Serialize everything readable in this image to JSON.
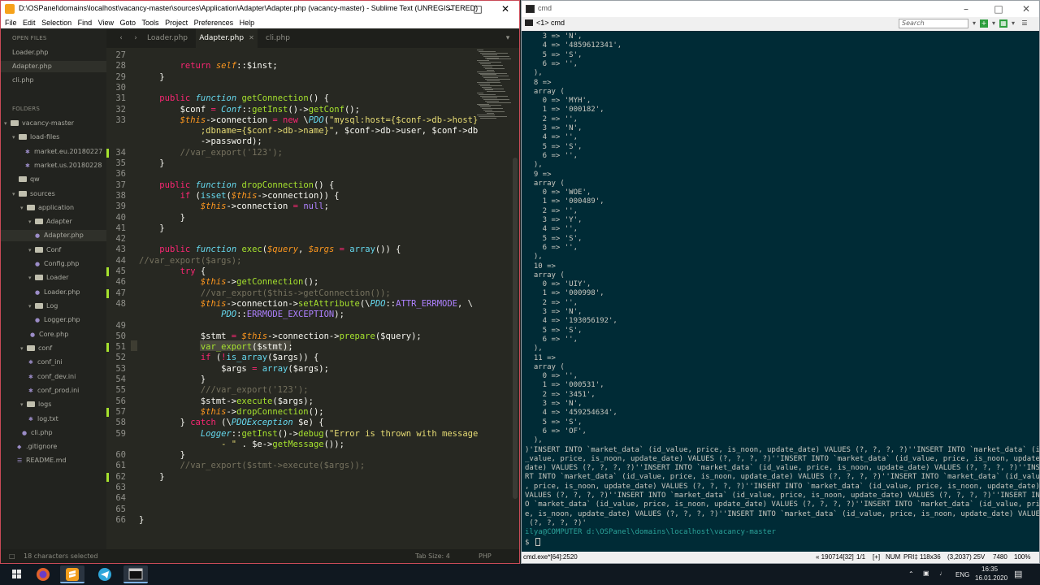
{
  "sublime": {
    "title": "D:\\OSPanel\\domains\\localhost\\vacancy-master\\sources\\Application\\Adapter\\Adapter.php (vacancy-master) - Sublime Text (UNREGISTERED)",
    "menu": [
      "File",
      "Edit",
      "Selection",
      "Find",
      "View",
      "Goto",
      "Tools",
      "Project",
      "Preferences",
      "Help"
    ],
    "sidebar": {
      "open_files_header": "OPEN FILES",
      "open_files": [
        "Loader.php",
        "Adapter.php",
        "cli.php"
      ],
      "folders_header": "FOLDERS",
      "tree": [
        {
          "label": "vacancy-master",
          "type": "folder"
        },
        {
          "label": "load-files",
          "type": "folder"
        },
        {
          "label": "market.eu.20180227",
          "type": "file"
        },
        {
          "label": "market.us.20180228",
          "type": "file"
        },
        {
          "label": "qw",
          "type": "folder"
        },
        {
          "label": "sources",
          "type": "folder"
        },
        {
          "label": "application",
          "type": "folder"
        },
        {
          "label": "Adapter",
          "type": "folder"
        },
        {
          "label": "Adapter.php",
          "type": "file"
        },
        {
          "label": "Conf",
          "type": "folder"
        },
        {
          "label": "Config.php",
          "type": "file"
        },
        {
          "label": "Loader",
          "type": "folder"
        },
        {
          "label": "Loader.php",
          "type": "file"
        },
        {
          "label": "Log",
          "type": "folder"
        },
        {
          "label": "Logger.php",
          "type": "file"
        },
        {
          "label": "Core.php",
          "type": "file"
        },
        {
          "label": "conf",
          "type": "folder"
        },
        {
          "label": "conf_ini",
          "type": "file"
        },
        {
          "label": "conf_dev.ini",
          "type": "file"
        },
        {
          "label": "conf_prod.ini",
          "type": "file"
        },
        {
          "label": "logs",
          "type": "folder"
        },
        {
          "label": "log.txt",
          "type": "file"
        },
        {
          "label": "cli.php",
          "type": "file"
        },
        {
          "label": ".gitignore",
          "type": "file"
        },
        {
          "label": "README.md",
          "type": "file"
        }
      ]
    },
    "tabs": [
      "Loader.php",
      "Adapter.php",
      "cli.php"
    ],
    "active_tab": "Adapter.php",
    "line_numbers": [
      "27",
      "28",
      "29",
      "30",
      "31",
      "32",
      "33",
      "",
      "",
      "34",
      "35",
      "36",
      "37",
      "38",
      "39",
      "40",
      "41",
      "42",
      "43",
      "44",
      "45",
      "46",
      "47",
      "48",
      "",
      "49",
      "50",
      "51",
      "52",
      "53",
      "54",
      "55",
      "56",
      "57",
      "58",
      "59",
      "",
      "60",
      "61",
      "62",
      "63",
      "64",
      "65",
      "66"
    ],
    "status": {
      "selection": "18 characters selected",
      "tab_size": "Tab Size: 4",
      "syntax": "PHP"
    }
  },
  "console": {
    "title": "cmd",
    "tab_label": "<1> cmd",
    "search_placeholder": "Search",
    "lines": [
      "    3 => 'N',",
      "    4 => '4859612341',",
      "    5 => 'S',",
      "    6 => '',",
      "  ),",
      "  8 =>",
      "  array (",
      "    0 => 'MYH',",
      "    1 => '000182',",
      "    2 => '',",
      "    3 => 'N',",
      "    4 => '',",
      "    5 => 'S',",
      "    6 => '',",
      "  ),",
      "  9 =>",
      "  array (",
      "    0 => 'WOE',",
      "    1 => '000489',",
      "    2 => '',",
      "    3 => 'Y',",
      "    4 => '',",
      "    5 => 'S',",
      "    6 => '',",
      "  ),",
      "  10 =>",
      "  array (",
      "    0 => 'UIY',",
      "    1 => '000998',",
      "    2 => '',",
      "    3 => 'N',",
      "    4 => '193056192',",
      "    5 => 'S',",
      "    6 => '',",
      "  ),",
      "  11 =>",
      "  array (",
      "    0 => '',",
      "    1 => '000531',",
      "    2 => '3451',",
      "    3 => 'N',",
      "    4 => '459254634',",
      "    5 => 'S',",
      "    6 => 'OF',",
      "  ),",
      ")'INSERT INTO `market_data` (id_value, price, is_noon, update_date) VALUES (?, ?, ?, ?)''INSERT INTO `market_data` (id",
      "_value, price, is_noon, update_date) VALUES (?, ?, ?, ?)''INSERT INTO `market_data` (id_value, price, is_noon, update_",
      "date) VALUES (?, ?, ?, ?)''INSERT INTO `market_data` (id_value, price, is_noon, update_date) VALUES (?, ?, ?, ?)''INSE",
      "RT INTO `market_data` (id_value, price, is_noon, update_date) VALUES (?, ?, ?, ?)''INSERT INTO `market_data` (id_value",
      ", price, is_noon, update_date) VALUES (?, ?, ?, ?)''INSERT INTO `market_data` (id_value, price, is_noon, update_date)",
      "VALUES (?, ?, ?, ?)''INSERT INTO `market_data` (id_value, price, is_noon, update_date) VALUES (?, ?, ?, ?)''INSERT INT",
      "O `market_data` (id_value, price, is_noon, update_date) VALUES (?, ?, ?, ?)''INSERT INTO `market_data` (id_value, pric",
      "e, is_noon, update_date) VALUES (?, ?, ?, ?)''INSERT INTO `market_data` (id_value, price, is_noon, update_date) VALUES",
      " (?, ?, ?, ?)'"
    ],
    "prompt_user": "ilya@COMPUTER",
    "prompt_path": "d:\\OSPanel\\domains\\localhost\\vacancy-master",
    "prompt_symbol": "$",
    "status": {
      "process": "cmd.exe*[64]:2520",
      "pos": "« 190714[32]",
      "page": "1/1",
      "plus": "[+]",
      "num": "NUM",
      "pri": "PRI‡",
      "size": "118x36",
      "coords": "(3,2037) 25V",
      "pid": "7480",
      "zoom": "100%"
    }
  },
  "taskbar": {
    "lang": "ENG",
    "time": "16:35",
    "date": "16.01.2020"
  }
}
